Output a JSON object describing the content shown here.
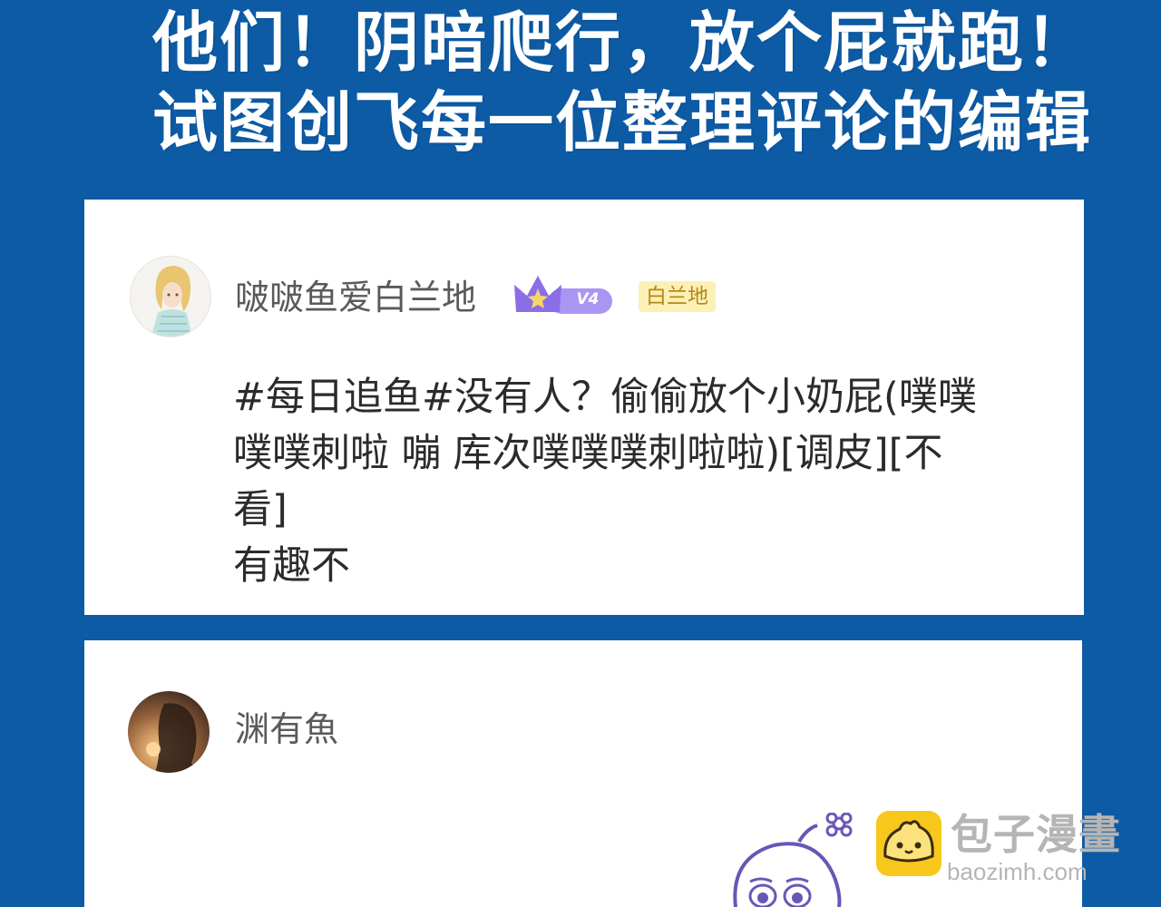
{
  "headline": {
    "line1": "他们！阴暗爬行，放个屁就跑！",
    "line2": "试图创飞每一位整理评论的编辑"
  },
  "comments": [
    {
      "username": "啵啵鱼爱白兰地",
      "vip_level": "V4",
      "tag": "白兰地",
      "avatar_icon": "avatar-blonde-character-icon",
      "lines": [
        "#每日追鱼#没有人？偷偷放个小奶屁(噗噗",
        "噗噗刺啦  嘣  库次噗噗噗刺啦啦)[调皮][不",
        "看]",
        "有趣不"
      ]
    },
    {
      "username": "渊有魚",
      "avatar_icon": "avatar-sunset-silhouette-icon",
      "sticker_icon": "crying-mascot-sticker-icon"
    }
  ],
  "watermark": {
    "title": "包子漫畫",
    "domain": "baozimh.com",
    "logo_icon": "bun-logo-icon"
  },
  "colors": {
    "background": "#0d5ba5",
    "card": "#ffffff",
    "vip_purple": "#8b6de8",
    "tag_bg": "#fdf0b6",
    "tag_text": "#b38a13",
    "logo_yellow": "#f7c81b"
  }
}
